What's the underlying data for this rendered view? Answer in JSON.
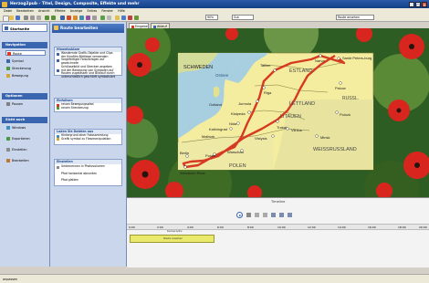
{
  "app": {
    "title": "Herzog2pub - Titel, Design, Composite, Effekte und mehr",
    "window_buttons": [
      "_",
      "□",
      "x"
    ]
  },
  "menu": [
    "Datei",
    "Bearbeiten",
    "Ansicht",
    "Effekte",
    "Anzeige",
    "Extras",
    "Fenster",
    "Hilfe"
  ],
  "toolbar": {
    "zoom_value": "90%",
    "quality_value": "Gut",
    "preview_value": "Route ansehen"
  },
  "sidebar": {
    "start_label": "Startseite",
    "navigation_header": "Navigation",
    "nav_items": [
      {
        "label": "Route",
        "icon": "route-icon",
        "selected": true
      },
      {
        "label": "Symbol",
        "icon": "symbol-icon"
      },
      {
        "label": "Streckenzug",
        "icon": "polyline-icon"
      },
      {
        "label": "Bewegung",
        "icon": "motion-icon"
      }
    ],
    "options_header": "Optionen",
    "option_items": [
      {
        "label": "Pausen",
        "icon": "pause-icon"
      }
    ],
    "view_header": "Sicht auch",
    "view_items": [
      {
        "label": "Windows",
        "icon": "window-icon"
      },
      {
        "label": "Exportieren",
        "icon": "export-icon"
      },
      {
        "label": "Einstellen",
        "icon": "settings-icon"
      },
      {
        "label": "Bearbeiten",
        "icon": "edit-icon"
      }
    ]
  },
  "panel": {
    "header": "Route bearbeiten",
    "groups": [
      {
        "title": "Hinweisskizze",
        "lines": [
          "Wandernde Grafik-Objekte und Clips",
          "der Kinofilm-Bildfolge verwenden",
          "Vorgefertigte Farbvorlagen auf gezeichnete",
          "Schlüsselbild und Strecken angeben",
          "mit der Bewegung von Symbolen auf",
          "Routen zugelassen und Bildlauf durch",
          "unterschiedlich geschärft symbolisiert"
        ]
      },
      {
        "title": "Einfallsen",
        "lines": [
          "neuen Bewegungspfad",
          "neuen Streckenzug"
        ]
      },
      {
        "title": "Laden Sie Dateien aus",
        "lines": [
          "Hintergrund einer Fotosammlung",
          "Grafik symbol zu Flowmanipulation"
        ]
      },
      {
        "title": "Einstellen",
        "lines": [
          "Umbenennen in Photovolumen",
          "Pfad horizontal abrunden",
          "Pfad glatten"
        ]
      }
    ]
  },
  "editor": {
    "tabs": [
      "Eingabe",
      "Ablauf"
    ],
    "map": {
      "countries": [
        "SCHWEDEN",
        "ESTLAND",
        "LETTLAND",
        "LITAUEN",
        "POLEN",
        "WEISSRUSSLAND",
        "RUSSL."
      ],
      "sea": "Ostsee",
      "cities": [
        "Sankt Peters-burg",
        "Narva",
        "Tallinn",
        "Pskow",
        "Gotland",
        "Riga",
        "Jurmola",
        "Klaipeda",
        "Nida",
        "Kaliningrad",
        "Malbork",
        "Trakai",
        "Vilnius",
        "Vistysis",
        "Polozk",
        "Minsk",
        "Warschau",
        "Posen",
        "Berlin",
        "Wendisch Rietz"
      ]
    }
  },
  "timeline": {
    "label": "Timeline",
    "ticks": [
      "0:00",
      "2:00",
      "4:00",
      "6:00",
      "8:00",
      "10:00",
      "12:00",
      "14:00",
      "16:00",
      "18:00",
      "20:00"
    ],
    "clip_label": "Route ansehen",
    "track_label": "Kameradnr."
  },
  "status": {
    "text": "anpassen"
  },
  "colors": {
    "title_bar": "#1e4a95",
    "route": "#d63a22",
    "panel_header": "#3a66b0",
    "timeline_clip": "#e9e96c"
  }
}
